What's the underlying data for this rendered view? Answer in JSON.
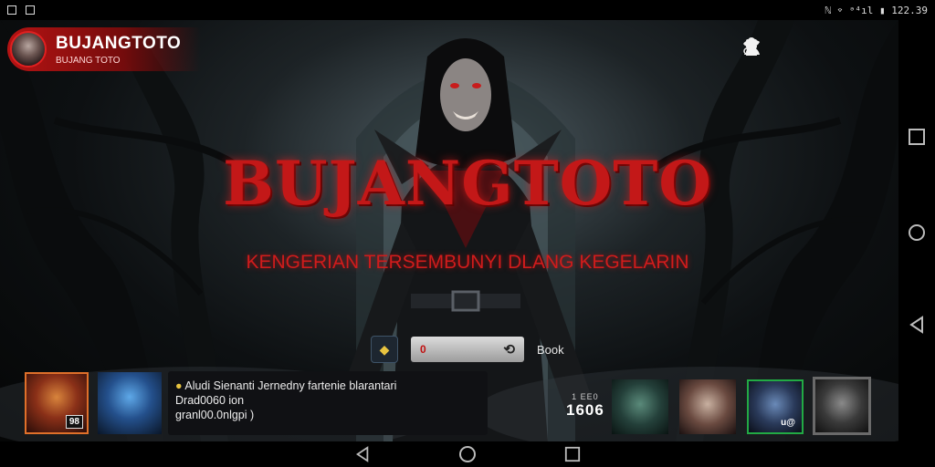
{
  "status_bar": {
    "right_text": "ℕ ⌔ ᵊ⁴ıl ▮ 122.39"
  },
  "header": {
    "app_title": "BUJANGTOTO",
    "app_subtitle": "BUJANG TOTO",
    "icons": [
      "bird-icon",
      "user-settings-icon",
      "person-icon",
      "more-vert-icon"
    ]
  },
  "hero": {
    "title": "BUJANGTOTO",
    "tagline": "KENGERIAN TERSEMBUNYI DLANG KEGELARIN"
  },
  "controls": {
    "field_value": "0",
    "book_label": "Book"
  },
  "info_panel": {
    "line1": "Aludi Sienanti Jernedny fartenie blarantari",
    "line2": "Drad0060 ion",
    "line3": "granl00.0nlgpi )"
  },
  "thumbnails_left": [
    {
      "tag": "98"
    },
    {
      "tag": ""
    }
  ],
  "score": {
    "small": "1 EE0",
    "big": "1606"
  },
  "thumbnails_right": [
    {
      "tag": ""
    },
    {
      "tag": ""
    },
    {
      "tag": "u@"
    },
    {
      "tag": ""
    }
  ],
  "colors": {
    "accent_red": "#c31818",
    "panel": "#101114",
    "thumb_border_orange": "#e0702a",
    "thumb_border_green": "#22aa44",
    "thumb_border_grey": "#6a6a6a"
  }
}
